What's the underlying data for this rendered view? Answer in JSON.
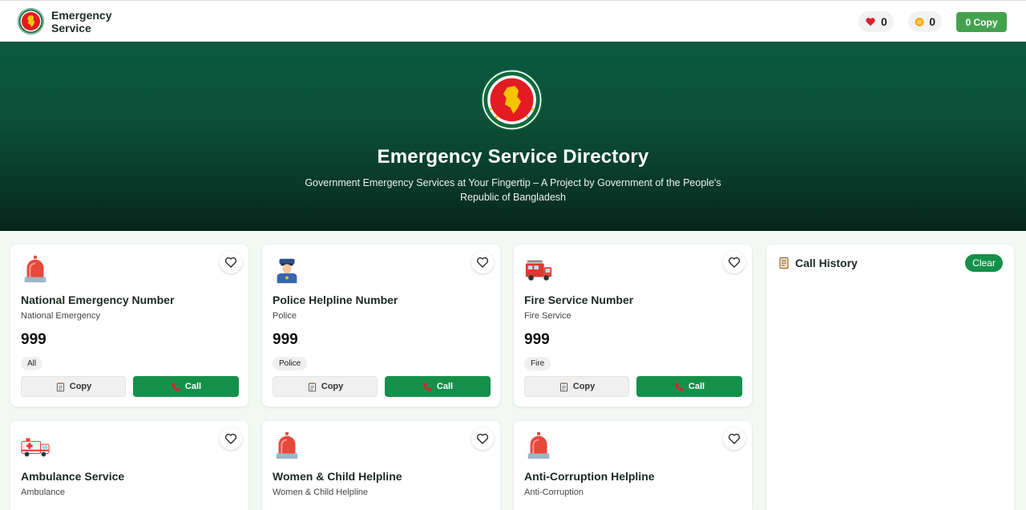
{
  "nav": {
    "brand_line1": "Emergency",
    "brand_line2": "Service",
    "heart_count": "0",
    "coin_count": "0",
    "copy_button": "0 Copy"
  },
  "hero": {
    "title": "Emergency Service Directory",
    "subtitle": "Government Emergency Services at Your Fingertip – A Project by Government of the People's Republic of Bangladesh"
  },
  "cards": [
    {
      "title": "National Emergency Number",
      "subtitle": "National Emergency",
      "number": "999",
      "tag": "All",
      "copy_label": "Copy",
      "call_label": "Call",
      "icon": "siren-icon"
    },
    {
      "title": "Police Helpline Number",
      "subtitle": "Police",
      "number": "999",
      "tag": "Police",
      "copy_label": "Copy",
      "call_label": "Call",
      "icon": "police-icon"
    },
    {
      "title": "Fire Service Number",
      "subtitle": "Fire Service",
      "number": "999",
      "tag": "Fire",
      "copy_label": "Copy",
      "call_label": "Call",
      "icon": "fire-truck-icon"
    },
    {
      "title": "Ambulance Service",
      "subtitle": "Ambulance",
      "icon": "ambulance-icon"
    },
    {
      "title": "Women & Child Helpline",
      "subtitle": "Women & Child Helpline",
      "icon": "siren-icon"
    },
    {
      "title": "Anti-Corruption Helpline",
      "subtitle": "Anti-Corruption",
      "icon": "siren-icon"
    }
  ],
  "history": {
    "title": "Call History",
    "clear_label": "Clear"
  },
  "colors": {
    "primary_green": "#15904a",
    "hero_dark": "#0b5a40",
    "nav_copy_green": "#44a24f"
  }
}
